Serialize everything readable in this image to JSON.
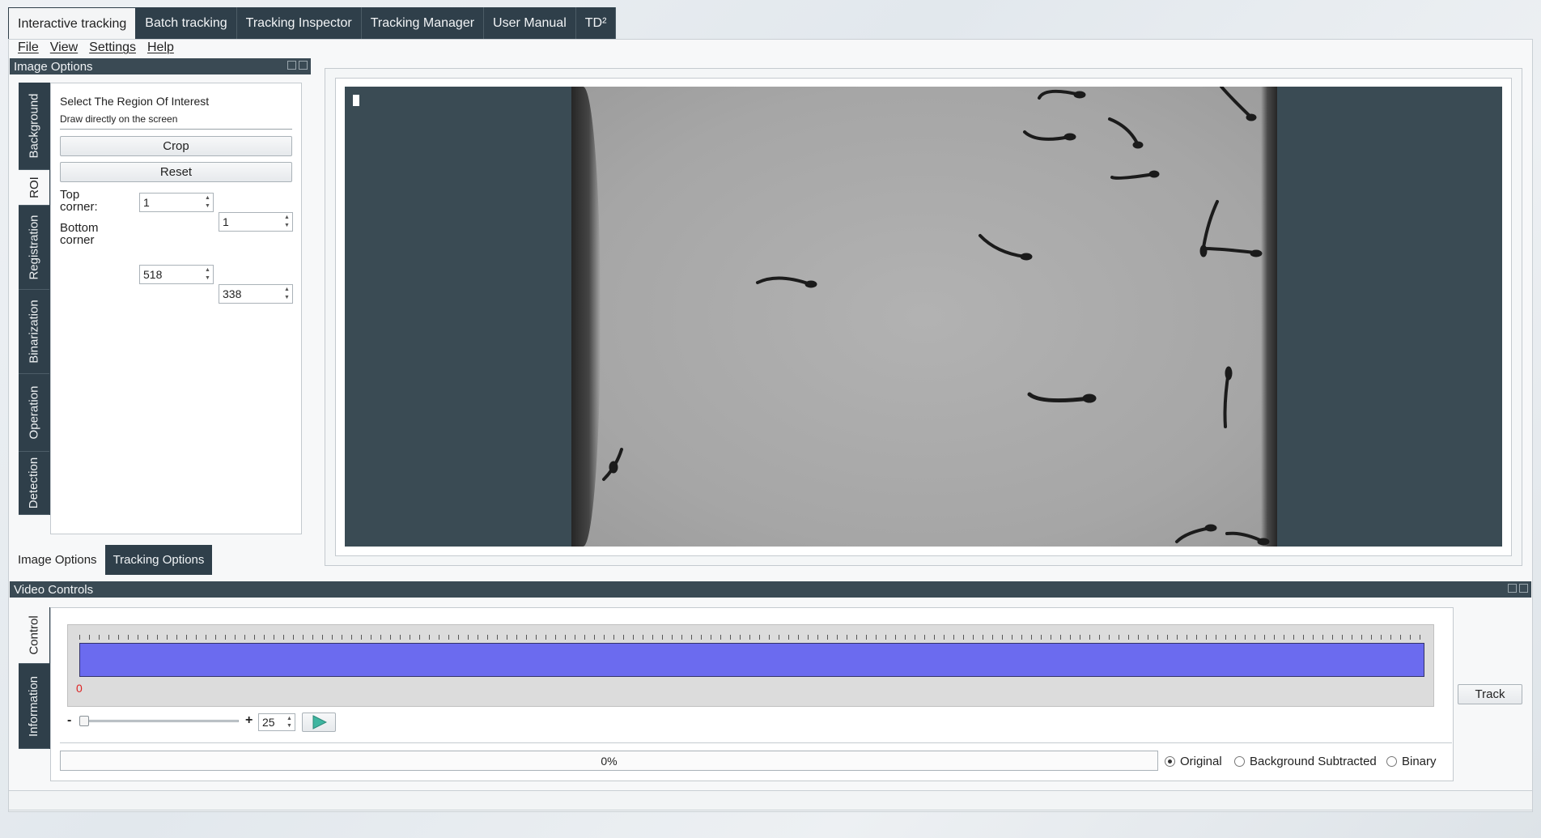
{
  "tabs": [
    "Interactive tracking",
    "Batch tracking",
    "Tracking Inspector",
    "Tracking Manager",
    "User Manual",
    "TD²"
  ],
  "menu": [
    "File",
    "View",
    "Settings",
    "Help"
  ],
  "image_options": {
    "title": "Image Options",
    "side_tabs": [
      "Background",
      "ROI",
      "Registration",
      "Binarization",
      "Operation",
      "Detection"
    ],
    "active_side_tab": "ROI",
    "roi": {
      "heading": "Select The Region Of Interest",
      "hint": "Draw directly on the screen",
      "crop_label": "Crop",
      "reset_label": "Reset",
      "top_corner_label": "Top corner:",
      "top_x": "1",
      "top_y": "1",
      "bottom_corner_label": "Bottom corner",
      "bottom_x": "518",
      "bottom_y": "338"
    }
  },
  "bottom_tabs": [
    "Image Options",
    "Tracking Options"
  ],
  "active_bottom_tab": "Image Options",
  "video_controls": {
    "title": "Video Controls",
    "side_tabs": [
      "Control",
      "Information"
    ],
    "active_side_tab": "Control",
    "frame_start": "0",
    "minus_label": "-",
    "plus_label": "+",
    "fps_value": "25",
    "track_label": "Track",
    "progress_text": "0%",
    "progress_fraction": 0,
    "radios": [
      {
        "label": "Original",
        "checked": true
      },
      {
        "label": "Background Subtracted",
        "checked": false
      },
      {
        "label": "Binary",
        "checked": false
      }
    ]
  },
  "colors": {
    "timeline": "#6b6bef",
    "dark": "#2f3f4a",
    "image_bg": "#3a4b54",
    "frame_grey": "#a8a8a8"
  }
}
